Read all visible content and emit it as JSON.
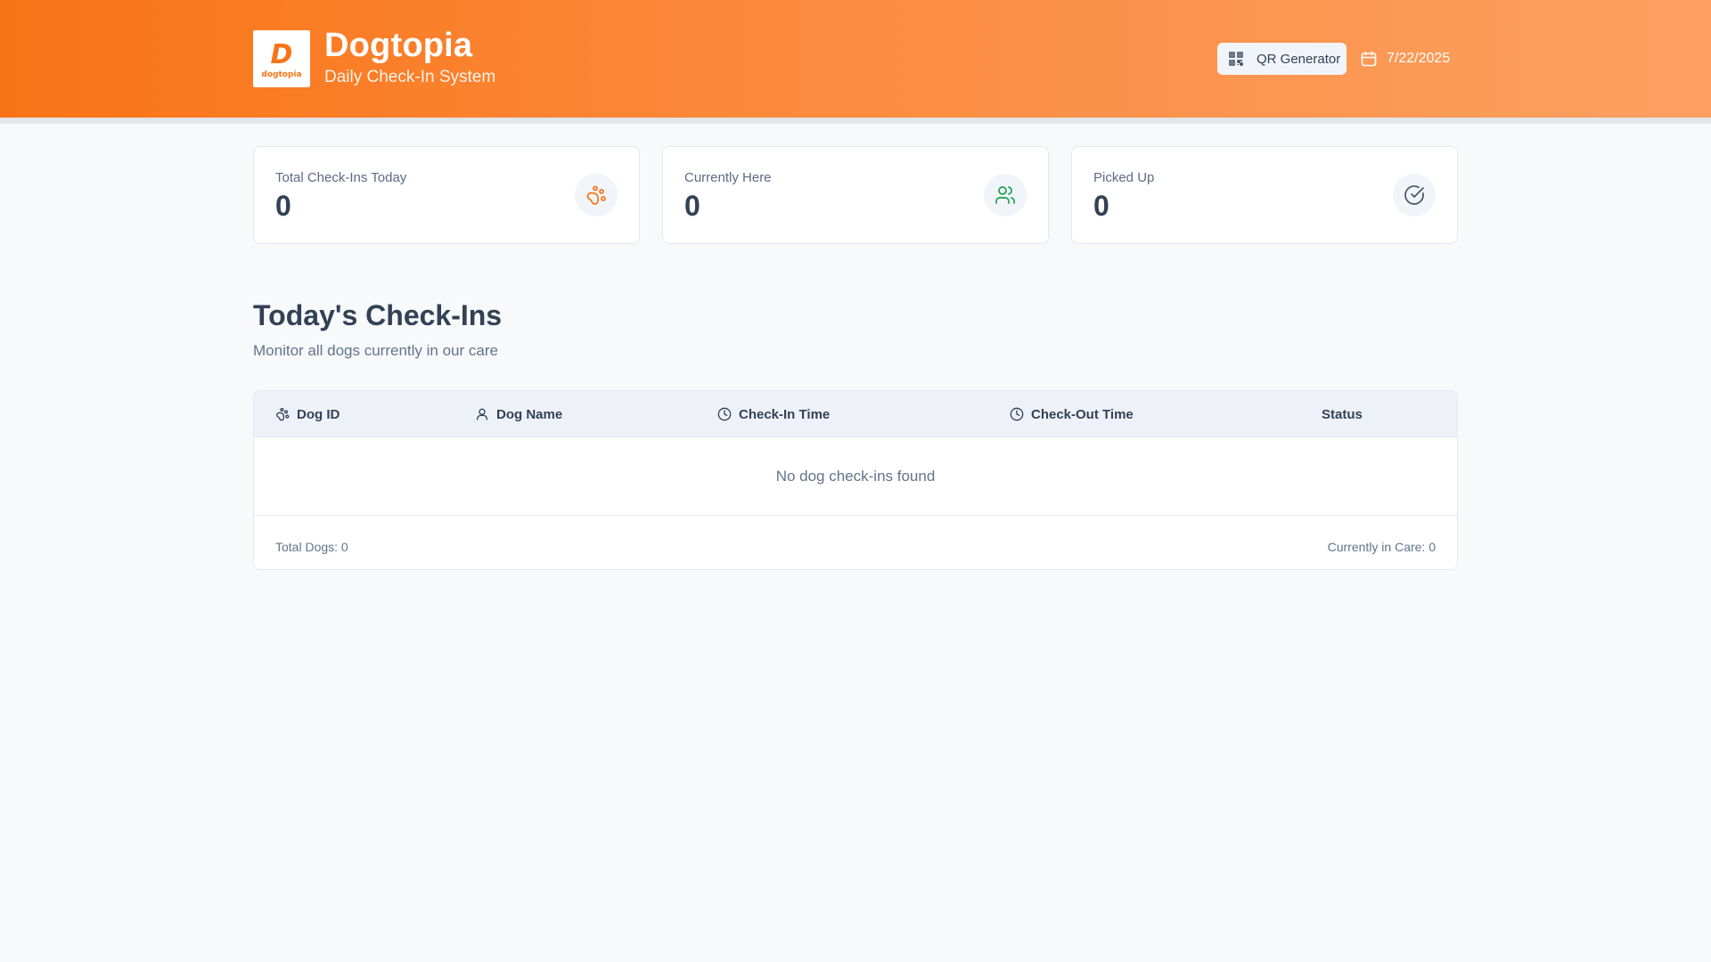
{
  "header": {
    "logo_mark": "D",
    "logo_word": "dogtopia",
    "title": "Dogtopia",
    "subtitle": "Daily Check-In System",
    "qr_button_label": "QR Generator",
    "date": "7/22/2025",
    "icons": {
      "qr": "qr-code-icon",
      "date": "calendar-icon"
    }
  },
  "stats": [
    {
      "label": "Total Check-Ins Today",
      "value": "0",
      "icon": "paw-icon",
      "icon_color": "#f97316"
    },
    {
      "label": "Currently Here",
      "value": "0",
      "icon": "users-icon",
      "icon_color": "#16a34a"
    },
    {
      "label": "Picked Up",
      "value": "0",
      "icon": "check-circle-icon",
      "icon_color": "#475569"
    }
  ],
  "section": {
    "title": "Today's Check-Ins",
    "subtitle": "Monitor all dogs currently in our care"
  },
  "table": {
    "columns": [
      {
        "label": "Dog ID",
        "icon": "paw-icon"
      },
      {
        "label": "Dog Name",
        "icon": "user-icon"
      },
      {
        "label": "Check-In Time",
        "icon": "clock-icon"
      },
      {
        "label": "Check-Out Time",
        "icon": "clock-icon"
      },
      {
        "label": "Status",
        "icon": ""
      }
    ],
    "empty_message": "No dog check-ins found",
    "footer_left": "Total Dogs: 0",
    "footer_right": "Currently in Care: 0"
  },
  "colors": {
    "brand_orange": "#f97316",
    "header_gradient_end": "#fda062",
    "page_bg": "#f7f9fb",
    "success_green": "#16a34a"
  }
}
